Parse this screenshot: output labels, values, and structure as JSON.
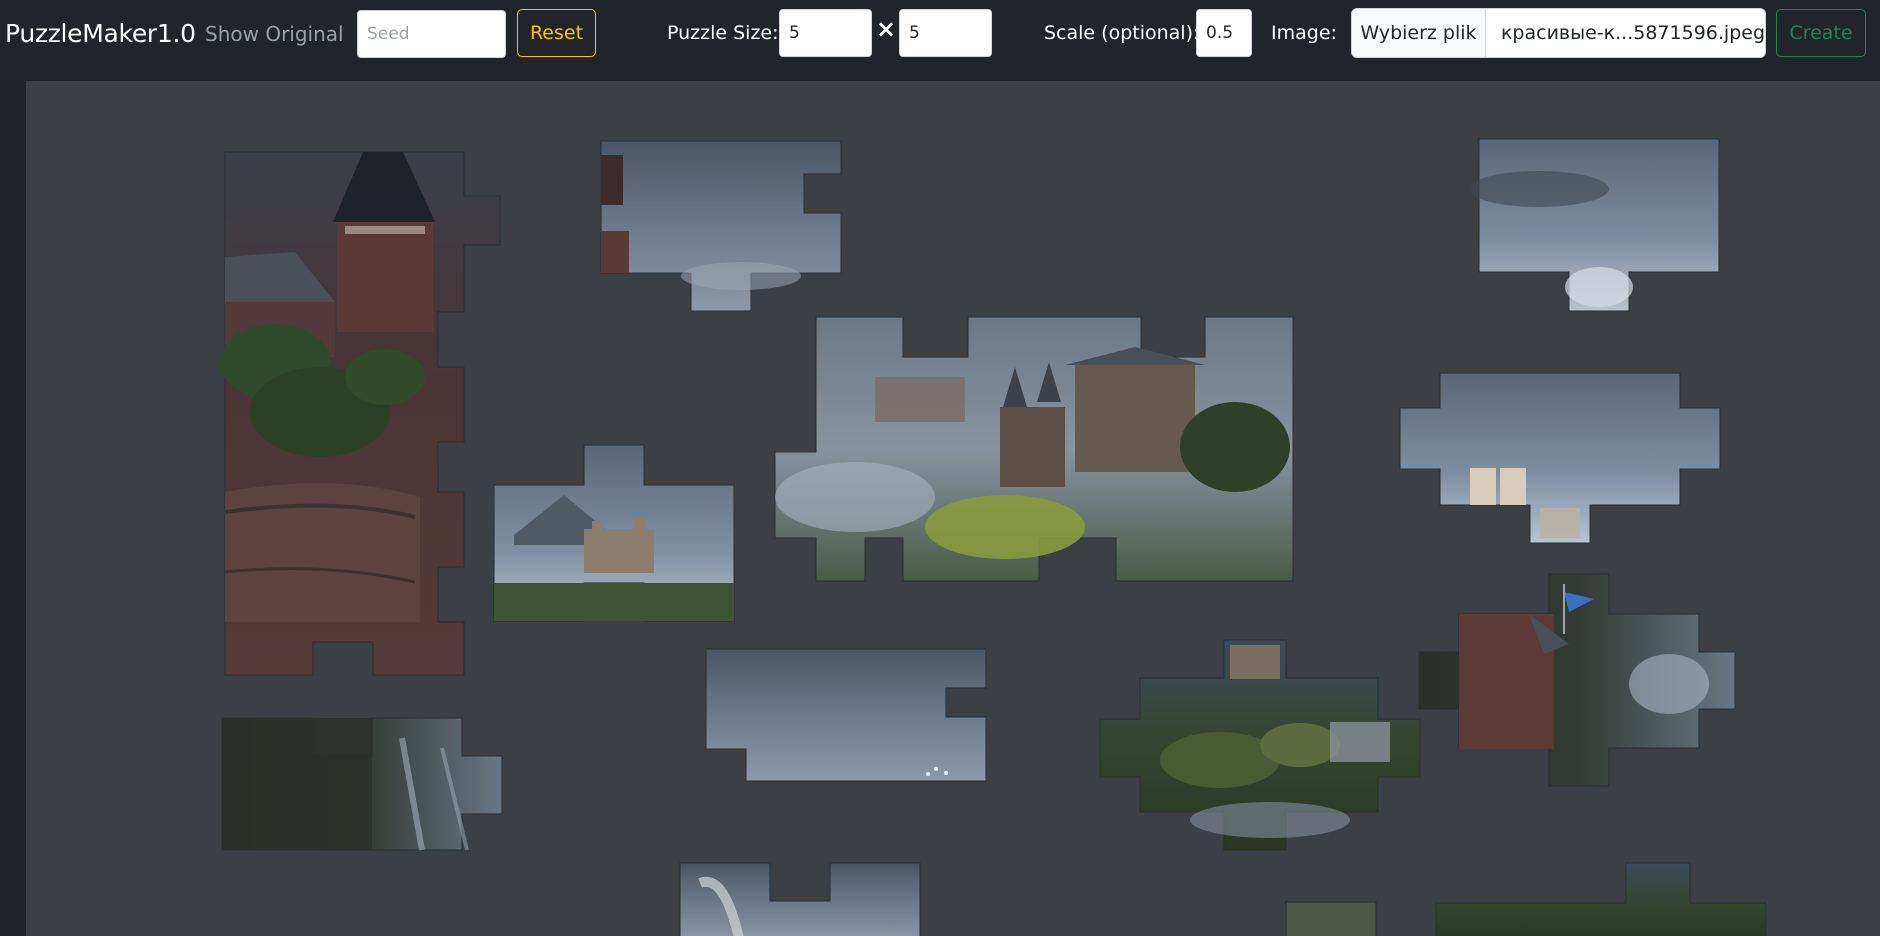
{
  "navbar": {
    "brand": "PuzzleMaker1.0",
    "show_original": "Show Original",
    "seed_placeholder": "Seed",
    "reset_label": "Reset",
    "puzzle_size_label": "Puzzle Size:",
    "size_width": "5",
    "size_times": "×",
    "size_height": "5",
    "scale_label": "Scale (optional):",
    "scale_value": "0.5",
    "image_label": "Image:",
    "file_button": "Wybierz plik",
    "file_name": "красивые-к...5871596.jpeg",
    "create_label": "Create"
  },
  "colors": {
    "navbar_bg": "#212529",
    "board_bg": "#3c3f43",
    "reset_accent": "#ffc107",
    "create_accent": "#198754",
    "sky": "#6f7d8f",
    "castle_red": "#5b3a38",
    "forest": "#2e3a28",
    "flag": "#3b6fc4"
  }
}
